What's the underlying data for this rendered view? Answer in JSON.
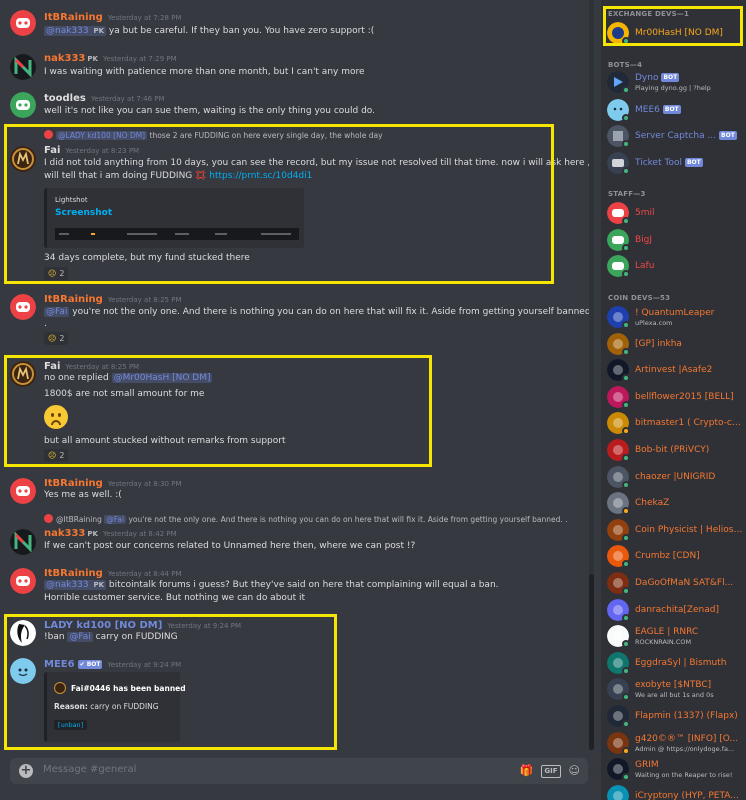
{
  "colors": {
    "chat_bg": "#36393f",
    "sidebar_bg": "#2f3136",
    "highlight": "#f4e600",
    "mention": "#7289da",
    "link": "#00b0f4",
    "coin_dev": "#f57731",
    "staff": "#f04747",
    "exchange_dev": "#faa61a",
    "bot": "#7289da",
    "user_name": "#3ba55c"
  },
  "messages": {
    "m1": {
      "user": "ItBRaining",
      "time": "Yesterday at 7:28 PM",
      "mention": "@nak333",
      "pk": "PK",
      "text": "ya but be careful. If they ban you. You have zero support :("
    },
    "m2": {
      "user": "nak333",
      "pk": "PK",
      "time": "Yesterday at 7:29 PM",
      "text": "I was waiting with patience more than one month, but I can't any more"
    },
    "m3": {
      "user": "toodles",
      "time": "Yesterday at 7:46 PM",
      "text": "well it's not like you can sue them, waiting is the only thing you could do."
    },
    "m4": {
      "reply_mention": "@LADY kd100 [NO DM]",
      "reply_text": "those 2 are FUDDING on here every single day, the whole day",
      "user": "Fai",
      "time": "Yesterday at 8:23 PM",
      "line1": "I did not told anything from 10 days, you can see the record, but my issue not resolved till that time. now i will ask here , so you",
      "line2": "will tell that i am doing FUDDING",
      "angry": "💢",
      "link": "https://prnt.sc/10d4di1",
      "embed_provider": "Lightshot",
      "embed_title": "Screenshot",
      "text2": "34 days complete, but my fund stucked there",
      "reaction_count": "2"
    },
    "m5": {
      "user": "ItBRaining",
      "time": "Yesterday at 8:25 PM",
      "mention": "@Fai",
      "text": "you're not the only one. And there is nothing you can do on here that will fix it. Aside from getting yourself banned.",
      "text2": ".",
      "reaction_count": "2"
    },
    "m6": {
      "user": "Fai",
      "time": "Yesterday at 8:25 PM",
      "text": "no one replied",
      "mention": "@Mr00HasH [NO DM]",
      "text2": "1800$ are not small amount for me",
      "text3": "but all amount stucked without remarks from support",
      "reaction_count": "2"
    },
    "m7": {
      "user": "ItBRaining",
      "time": "Yesterday at 8:30 PM",
      "text": "Yes me as well. :("
    },
    "m8": {
      "reply_name": "@ItBRaining",
      "reply_mention": "@Fai",
      "reply_text": "you're not the only one. And there is nothing you can do on here that will fix it. Aside from getting yourself banned. .",
      "user": "nak333",
      "pk": "PK",
      "time": "Yesterday at 8:42 PM",
      "text": "If we can't post our concerns related to Unnamed here then, where we can post  !?"
    },
    "m9": {
      "user": "ItBRaining",
      "time": "Yesterday at 8:44 PM",
      "mention": "@nak333",
      "pk": "PK",
      "text": "bitcointalk forums i guess? But they've said on here that complaining will equal a ban.",
      "text2": "Horrible customer service. But nothing we can do about it"
    },
    "m10": {
      "user": "LADY kd100 [NO DM]",
      "time": "Yesterday at 9:24 PM",
      "text": "!ban",
      "mention": "@Fai",
      "text2": "carry on FUDDING"
    },
    "m11": {
      "user": "MEE6",
      "bot": "BOT",
      "time": "Yesterday at 9:24 PM",
      "embed_title": "Fai#0446 has been banned",
      "reason_label": "Reason:",
      "reason": "carry on FUDDING",
      "unban": "[unban]"
    }
  },
  "composer": {
    "placeholder": "Message #general",
    "gif": "GIF"
  },
  "members": {
    "exchange_header": "EXCHANGE DEVS—1",
    "exchange": [
      {
        "name": "Mr00HasH [NO DM]"
      }
    ],
    "bots_header": "BOTS—4",
    "bots": [
      {
        "name": "Dyno",
        "tag": "BOT",
        "sub": "Playing dyno.gg | ?help"
      },
      {
        "name": "MEE6",
        "tag": "BOT"
      },
      {
        "name": "Server Captcha ...",
        "tag": "BOT"
      },
      {
        "name": "Ticket Tool",
        "tag": "BOT"
      }
    ],
    "staff_header": "STAFF—3",
    "staff": [
      {
        "name": "5mil"
      },
      {
        "name": "BigJ"
      },
      {
        "name": "Lafu"
      }
    ],
    "coin_header": "COIN DEVS—53",
    "coin": [
      {
        "name": "! QuantumLeaper",
        "sub": "uPlexa.com"
      },
      {
        "name": "[GP] inkha"
      },
      {
        "name": "Artinvest |Asafe2"
      },
      {
        "name": "bellflower2015 [BELL]"
      },
      {
        "name": "bitmaster1 ( Crypto-cit..."
      },
      {
        "name": "Bob-bit (PRiVCY)"
      },
      {
        "name": "chaozer |UNIGRID"
      },
      {
        "name": "ChekaZ"
      },
      {
        "name": "Coin Physicist | Helios ..."
      },
      {
        "name": "Crumbz [CDN]"
      },
      {
        "name": "DaGoOfMaN SAT&Fl..."
      },
      {
        "name": "danrachita[Zenad]"
      },
      {
        "name": "EAGLE | RNRC",
        "sub": "ROCKNRAIN.COM"
      },
      {
        "name": "EggdraSyl | Bismuth"
      },
      {
        "name": "exobyte [$NTBC]",
        "sub": "We are all but 1s and 0s"
      },
      {
        "name": "Flapmin (1337) (Flapx)"
      },
      {
        "name": "g420©®™ [INFO] [O...",
        "sub": "Admin @ https://onlydoge.fa..."
      },
      {
        "name": "GRIM",
        "sub": "Waiting on the Reaper to rise!"
      },
      {
        "name": "iCryptony (HYP, PETA..."
      }
    ]
  }
}
